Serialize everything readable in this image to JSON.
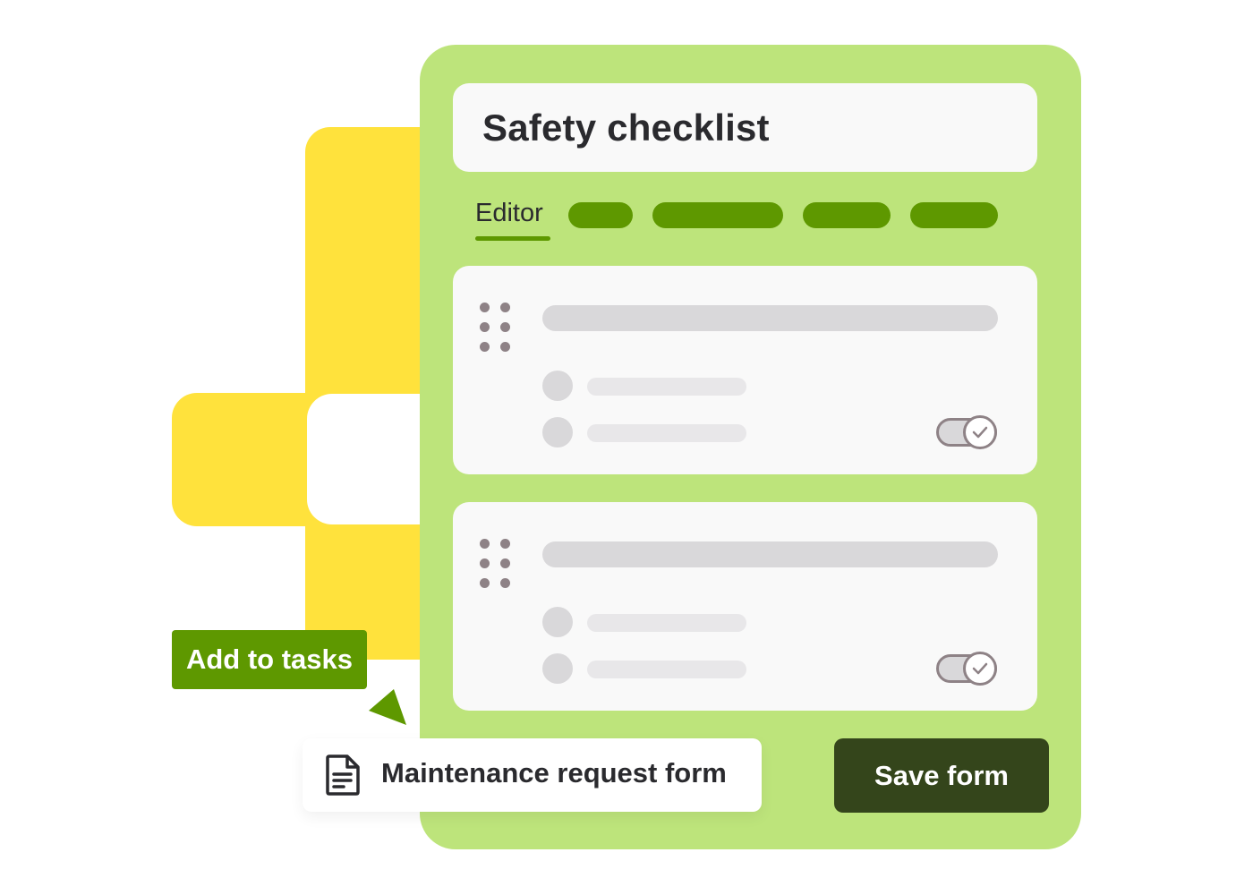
{
  "form": {
    "title": "Safety checklist"
  },
  "tabs": {
    "active_label": "Editor"
  },
  "actions": {
    "add_to_tasks_label": "Add to tasks",
    "save_label": "Save form"
  },
  "form_chip": {
    "label": "Maintenance request form",
    "icon": "document-icon"
  },
  "questions": [
    {
      "drag_icon": "drag-handle-icon",
      "toggle_on": true
    },
    {
      "drag_icon": "drag-handle-icon",
      "toggle_on": true
    }
  ],
  "colors": {
    "panel": "#bde47b",
    "accent_green": "#5e9800",
    "dark_button": "#34451b",
    "yellow_shape": "#ffe23c"
  }
}
